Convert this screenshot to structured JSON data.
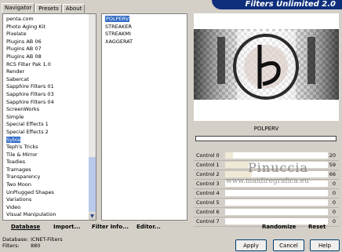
{
  "app": {
    "title": "Filters Unlimited 2.0"
  },
  "tabs": [
    {
      "label": "Navigator"
    },
    {
      "label": "Presets"
    },
    {
      "label": "About"
    }
  ],
  "categories": [
    "penta.com",
    "Photo Aging Kit",
    "Pixelate",
    "Plugins AB 06",
    "Plugins AB 07",
    "Plugins AB 08",
    "RCS Filter Pak 1.0",
    "Render",
    "Sabercat",
    "Sapphire Filters 01",
    "Sapphire Filters 03",
    "Sapphire Filters 04",
    "ScreenWorks",
    "Simple",
    "Special Effects 1",
    "Special Effects 2",
    "Sybia",
    "Teph's Tricks",
    "Tile & Mirror",
    "Toadies",
    "Tramages",
    "Transparency",
    "Two Moon",
    "UnPlugged Shapes",
    "Variations",
    "Video",
    "Visual Manipulation"
  ],
  "selected_category": "Sybia",
  "effects": [
    "POLPERV",
    "STREAKER",
    "STREAKMI",
    "XAGGERAT"
  ],
  "selected_effect": "POLPERV",
  "filter_name": "POLPERV",
  "controls": [
    {
      "label": "Control 0",
      "value": 20
    },
    {
      "label": "Control 1",
      "value": 59
    },
    {
      "label": "Control 2",
      "value": 66
    },
    {
      "label": "Control 3",
      "value": 0
    },
    {
      "label": "Control 4",
      "value": 0
    },
    {
      "label": "Control 5",
      "value": 0
    },
    {
      "label": "Control 6",
      "value": 0
    },
    {
      "label": "Control 7",
      "value": 0
    }
  ],
  "watermark": {
    "name": "Pinuccia",
    "url": "www.maidiregrafica.eu"
  },
  "toolbar": {
    "database": "Database",
    "import": "Import...",
    "filter_info": "Filter Info...",
    "editor": "Editor...",
    "randomize": "Randomize",
    "reset": "Reset"
  },
  "status": {
    "database_label": "Database:",
    "database_value": "ICNET-Filters",
    "filters_label": "Filters:",
    "filters_value": "880"
  },
  "dialog": {
    "apply": "Apply",
    "cancel": "Cancel",
    "help": "Help"
  },
  "colors": {
    "banner": "#0f2f7c",
    "selection": "#316ac5",
    "panel": "#d4d0c8"
  }
}
